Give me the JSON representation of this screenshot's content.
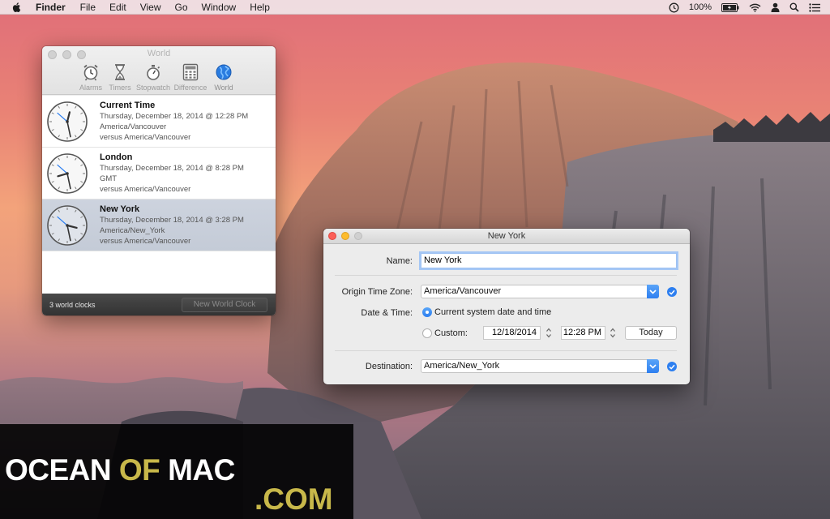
{
  "menubar": {
    "apple_icon": "apple-icon",
    "app_name": "Finder",
    "items": [
      "File",
      "Edit",
      "View",
      "Go",
      "Window",
      "Help"
    ],
    "status": {
      "battery_percent": "100%",
      "icons": [
        "time-machine-icon",
        "battery-icon",
        "wifi-icon",
        "user-icon",
        "spotlight-search-icon",
        "notification-center-icon"
      ]
    }
  },
  "world_window": {
    "title": "World",
    "toolbar": [
      {
        "label": "Alarms",
        "icon": "alarm-clock-icon"
      },
      {
        "label": "Timers",
        "icon": "hourglass-icon"
      },
      {
        "label": "Stopwatch",
        "icon": "stopwatch-icon"
      },
      {
        "label": "Difference",
        "icon": "calculator-icon"
      },
      {
        "label": "World",
        "icon": "globe-icon"
      }
    ],
    "clocks": [
      {
        "name": "Current Time",
        "datetime": "Thursday, December 18, 2014 @ 12:28 PM",
        "zone": "America/Vancouver",
        "versus": "versus America/Vancouver",
        "hour": 12,
        "minute": 28,
        "selected": false
      },
      {
        "name": "London",
        "datetime": "Thursday, December 18, 2014 @ 8:28 PM",
        "zone": "GMT",
        "versus": "versus America/Vancouver",
        "hour": 8,
        "minute": 28,
        "selected": false
      },
      {
        "name": "New York",
        "datetime": "Thursday, December 18, 2014 @ 3:28 PM",
        "zone": "America/New_York",
        "versus": "versus America/Vancouver",
        "hour": 3,
        "minute": 28,
        "selected": true
      }
    ],
    "footer": {
      "count_label": "3 world clocks",
      "new_button_label": "New World Clock"
    }
  },
  "editor_window": {
    "title": "New York",
    "name_label": "Name:",
    "name_value": "New York",
    "origin_label": "Origin Time Zone:",
    "origin_value": "America/Vancouver",
    "datetime_label": "Date & Time:",
    "option_current": "Current system date and time",
    "option_custom": "Custom:",
    "selected_option": "current",
    "custom_date": "12/18/2014",
    "custom_time": "12:28 PM",
    "today_button": "Today",
    "destination_label": "Destination:",
    "destination_value": "America/New_York"
  },
  "watermark": {
    "word_ocean": "OCEAN",
    "word_of": "OF",
    "word_mac": "MAC",
    "suffix": ".COM",
    "colors": {
      "white": "#ffffff",
      "gold": "#c8b84a"
    }
  },
  "colors": {
    "accent": "#2d7ff0",
    "close": "#fc5f57",
    "minimize": "#fdbc2e"
  }
}
